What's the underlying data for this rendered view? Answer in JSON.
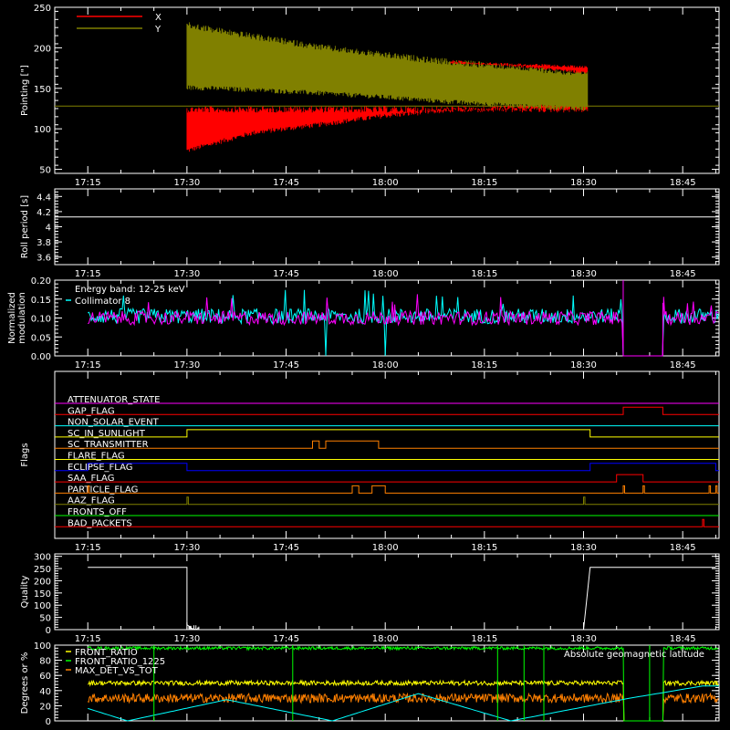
{
  "chart_data": {
    "type": "multi-panel",
    "time_ticks": [
      "17:15",
      "17:30",
      "17:45",
      "18:00",
      "18:15",
      "18:30",
      "18:45"
    ],
    "panels": [
      {
        "id": "pointing",
        "type": "line",
        "ylabel": "Pointing [\"]",
        "ylim": [
          45,
          250
        ],
        "yticks": [
          50,
          100,
          150,
          200,
          250
        ],
        "series": [
          {
            "name": "X",
            "color": "#ff0000",
            "baseline": 128,
            "start": "17:30",
            "end": "18:31",
            "lower": [
              [
                "17:30",
                70
              ],
              [
                "17:40",
                92
              ],
              [
                "17:50",
                102
              ],
              [
                "18:00",
                113
              ],
              [
                "18:10",
                120
              ],
              [
                "18:20",
                124
              ],
              [
                "18:30",
                127
              ]
            ],
            "upper": [
              [
                "17:30",
                155
              ],
              [
                "17:40",
                150
              ],
              [
                "17:50",
                145
              ],
              [
                "18:00",
                145
              ],
              [
                "18:05",
                148
              ],
              [
                "18:10",
                183
              ],
              [
                "18:20",
                181
              ],
              [
                "18:30",
                178
              ]
            ]
          },
          {
            "name": "Y",
            "color": "#808000",
            "baseline": 128,
            "start": "17:30",
            "end": "18:31",
            "lower": [
              [
                "17:30",
                148
              ],
              [
                "17:40",
                145
              ],
              [
                "17:50",
                141
              ],
              [
                "18:00",
                136
              ],
              [
                "18:10",
                130
              ],
              [
                "18:20",
                125
              ],
              [
                "18:30",
                122
              ]
            ],
            "upper": [
              [
                "17:30",
                232
              ],
              [
                "17:40",
                218
              ],
              [
                "17:50",
                205
              ],
              [
                "18:00",
                195
              ],
              [
                "18:10",
                186
              ],
              [
                "18:20",
                180
              ],
              [
                "18:30",
                172
              ]
            ]
          }
        ]
      },
      {
        "id": "roll",
        "type": "line",
        "ylabel": "Roll period [s]",
        "ylim": [
          3.5,
          4.5
        ],
        "yticks": [
          3.6,
          3.8,
          4.0,
          4.2,
          4.4
        ],
        "series": [
          {
            "name": "",
            "color": "#ffffff",
            "value": 4.13
          }
        ]
      },
      {
        "id": "modulation",
        "type": "line",
        "ylabel": [
          "Normalized",
          "modulation"
        ],
        "ylim": [
          0,
          0.2
        ],
        "yticks": [
          "0.00",
          "0.05",
          "0.10",
          "0.15",
          "0.20"
        ],
        "annotation": "Energy band: 12-25 keV",
        "series": [
          {
            "name": "Collimator 8",
            "color": "#00ffff",
            "mean": 0.105,
            "noise": 0.02
          },
          {
            "name": "",
            "color": "#ff00ff",
            "mean": 0.1,
            "noise": 0.018
          }
        ],
        "gap": {
          "start": "18:36",
          "end": "18:42"
        },
        "dips": [
          "17:51",
          "18:00"
        ]
      },
      {
        "id": "flags",
        "type": "line",
        "ylabel": "Flags",
        "flags": [
          {
            "name": "ATTENUATOR_STATE",
            "color": "#ff00ff",
            "segments": []
          },
          {
            "name": "GAP_FLAG",
            "color": "#ff0000",
            "segments": [
              [
                "18:36",
                "18:42"
              ]
            ]
          },
          {
            "name": "NON_SOLAR_EVENT",
            "color": "#00ffff",
            "segments": []
          },
          {
            "name": "SC_IN_SUNLIGHT",
            "color": "#ffff00",
            "segments": [
              [
                "17:30",
                "18:31"
              ]
            ]
          },
          {
            "name": "SC_TRANSMITTER",
            "color": "#ff8000",
            "segments": [
              [
                "17:49",
                "17:50"
              ],
              [
                "17:51",
                "17:59"
              ]
            ]
          },
          {
            "name": "FLARE_FLAG",
            "color": "#ffff00",
            "segments": []
          },
          {
            "name": "ECLIPSE_FLAG",
            "color": "#0000ff",
            "segments": [
              [
                "17:15",
                "17:30"
              ],
              [
                "18:31",
                "18:50"
              ]
            ]
          },
          {
            "name": "SAA_FLAG",
            "color": "#ff0000",
            "segments": [
              [
                "18:35",
                "18:39"
              ]
            ]
          },
          {
            "name": "PARTICLE_FLAG",
            "color": "#ff8000",
            "segments": [
              [
                "17:15",
                "17:15"
              ],
              [
                "17:55",
                "17:56"
              ],
              [
                "17:58",
                "18:00"
              ],
              [
                "18:36",
                "18:36"
              ],
              [
                "18:39",
                "18:39"
              ],
              [
                "18:49",
                "18:49"
              ],
              [
                "18:50",
                "18:50"
              ]
            ]
          },
          {
            "name": "AAZ_FLAG",
            "color": "#808000",
            "segments": [
              [
                "17:30",
                "17:30"
              ],
              [
                "18:30",
                "18:30"
              ]
            ]
          },
          {
            "name": "FRONTS_OFF",
            "color": "#00ff00",
            "segments": []
          },
          {
            "name": "BAD_PACKETS",
            "color": "#ff0000",
            "segments": [
              [
                "18:48",
                "18:48"
              ]
            ]
          }
        ]
      },
      {
        "id": "quality",
        "type": "line",
        "ylabel": "Quality",
        "ylim": [
          0,
          310
        ],
        "yticks": [
          0,
          50,
          100,
          150,
          200,
          250,
          300
        ],
        "series": [
          {
            "name": "",
            "color": "#ffffff",
            "points": [
              [
                "17:15",
                255
              ],
              [
                "17:30",
                255
              ],
              [
                "17:30",
                20
              ],
              [
                "17:31",
                0
              ],
              [
                "18:30",
                0
              ],
              [
                "18:31",
                255
              ],
              [
                "18:50",
                255
              ]
            ]
          }
        ]
      },
      {
        "id": "ratios",
        "type": "line",
        "ylabel": "Degrees or %",
        "ylim": [
          0,
          100
        ],
        "yticks": [
          0,
          20,
          40,
          60,
          80,
          100
        ],
        "annotation": "Absolute geomagnetic latitude",
        "series": [
          {
            "name": "FRONT_RATIO",
            "color": "#ffff00",
            "mean": 50
          },
          {
            "name": "FRONT_RATIO_1225",
            "color": "#00ff00",
            "mean": 97
          },
          {
            "name": "MAX_DET_VS_TOT",
            "color": "#ff8000",
            "mean": 30
          },
          {
            "name": "",
            "color": "#00ffff",
            "latitude": true
          }
        ]
      }
    ]
  }
}
